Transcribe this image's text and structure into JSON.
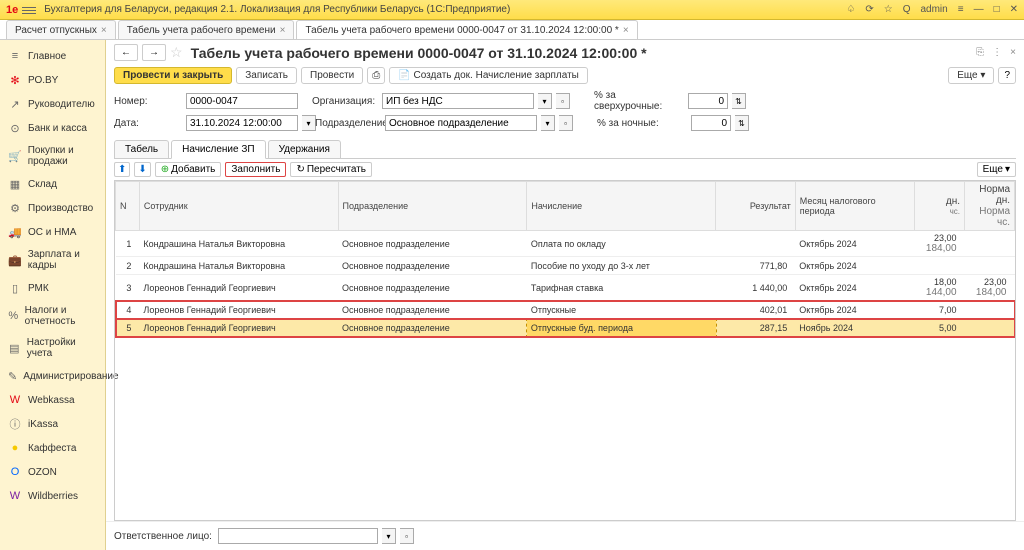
{
  "app": {
    "title": "Бухгалтерия для Беларуси, редакция 2.1. Локализация для Республики Беларусь   (1С:Предприятие)",
    "user": "admin"
  },
  "tabs": [
    {
      "label": "Расчет отпускных"
    },
    {
      "label": "Табель учета рабочего времени"
    },
    {
      "label": "Табель учета рабочего времени 0000-0047 от 31.10.2024 12:00:00 *"
    }
  ],
  "sidebar": [
    {
      "icon": "≡",
      "label": "Главное"
    },
    {
      "icon": "✻",
      "label": "РО.BY",
      "color": "#e30613"
    },
    {
      "icon": "↗",
      "label": "Руководителю"
    },
    {
      "icon": "⊙",
      "label": "Банк и касса"
    },
    {
      "icon": "🛒",
      "label": "Покупки и продажи"
    },
    {
      "icon": "▦",
      "label": "Склад"
    },
    {
      "icon": "⚙",
      "label": "Производство"
    },
    {
      "icon": "🚚",
      "label": "ОС и НМА"
    },
    {
      "icon": "💼",
      "label": "Зарплата и кадры"
    },
    {
      "icon": "▯",
      "label": "РМК"
    },
    {
      "icon": "%",
      "label": "Налоги и отчетность"
    },
    {
      "icon": "▤",
      "label": "Настройки учета"
    },
    {
      "icon": "✎",
      "label": "Администрирование"
    },
    {
      "icon": "W",
      "label": "Webkassa",
      "color": "#e30613"
    },
    {
      "icon": "ⓘ",
      "label": "iKassa"
    },
    {
      "icon": "●",
      "label": "Каффеста",
      "color": "#f6c900"
    },
    {
      "icon": "O",
      "label": "OZON",
      "color": "#0066ff"
    },
    {
      "icon": "W",
      "label": "Wildberries",
      "color": "#7b1fa2"
    }
  ],
  "doc": {
    "title": "Табель учета рабочего времени 0000-0047 от 31.10.2024 12:00:00 *",
    "buttons": {
      "post_close": "Провести и закрыть",
      "write": "Записать",
      "post": "Провести",
      "create": "Создать док. Начисление зарплаты",
      "more": "Еще"
    },
    "fields": {
      "number_label": "Номер:",
      "number": "0000-0047",
      "org_label": "Организация:",
      "org": "ИП без НДС",
      "pct_over_label": "% за сверхурочные:",
      "pct_over": "0",
      "date_label": "Дата:",
      "date": "31.10.2024 12:00:00",
      "dept_label": "Подразделение:",
      "dept": "Основное подразделение",
      "pct_night_label": "% за ночные:",
      "pct_night": "0"
    },
    "subtabs": [
      "Табель",
      "Начисление ЗП",
      "Удержания"
    ]
  },
  "tableToolbar": {
    "add": "Добавить",
    "fill": "Заполнить",
    "recalc": "Пересчитать",
    "more": "Еще"
  },
  "columns": {
    "n": "N",
    "emp": "Сотрудник",
    "dept": "Подразделение",
    "accr": "Начисление",
    "result": "Результат",
    "period": "Месяц налогового периода",
    "norm": "Норма",
    "sub_d": "дн.",
    "sub_h": "чс."
  },
  "rows": [
    {
      "n": "1",
      "emp": "Кондрашина Наталья Викторовна",
      "dept": "Основное подразделение",
      "accr": "Оплата по окладу",
      "result": "",
      "period": "Октябрь 2024",
      "d": "23,00",
      "h": "184,00"
    },
    {
      "n": "2",
      "emp": "Кондрашина Наталья Викторовна",
      "dept": "Основное подразделение",
      "accr": "Пособие по уходу до 3-х лет",
      "result": "771,80",
      "period": "Октябрь 2024",
      "d": "",
      "h": ""
    },
    {
      "n": "3",
      "emp": "Лореонов Геннадий Георгиевич",
      "dept": "Основное подразделение",
      "accr": "Тарифная ставка",
      "result": "1 440,00",
      "period": "Октябрь 2024",
      "d": "18,00",
      "h": "144,00",
      "d2": "23,00",
      "h2": "184,00"
    },
    {
      "n": "4",
      "emp": "Лореонов Геннадий Георгиевич",
      "dept": "Основное подразделение",
      "accr": "Отпускные",
      "result": "402,01",
      "period": "Октябрь 2024",
      "d": "7,00",
      "h": ""
    },
    {
      "n": "5",
      "emp": "Лореонов Геннадий Георгиевич",
      "dept": "Основное подразделение",
      "accr": "Отпускные буд. периода",
      "result": "287,15",
      "period": "Ноябрь 2024",
      "d": "5,00",
      "h": ""
    }
  ],
  "footer": {
    "label": "Ответственное лицо:"
  }
}
